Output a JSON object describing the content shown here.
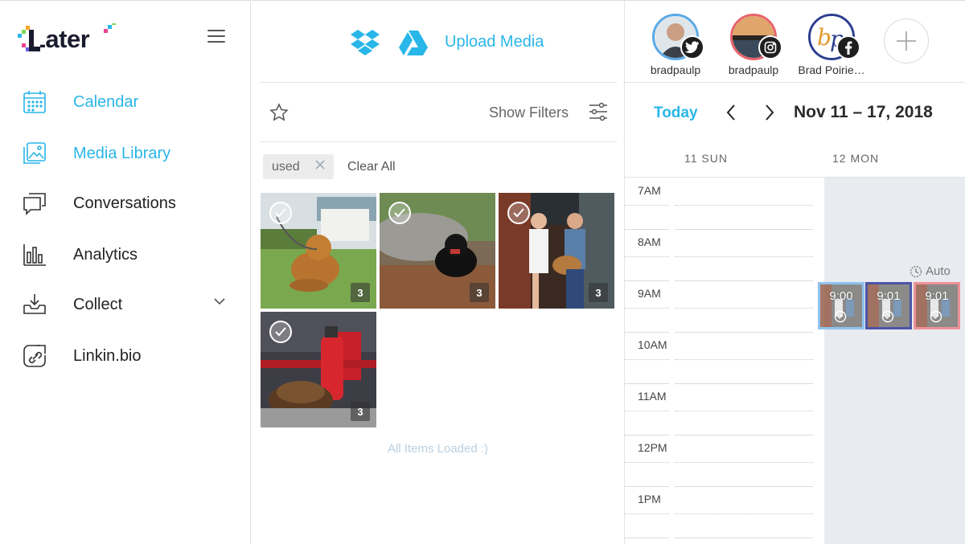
{
  "app": {
    "brand": "Later"
  },
  "sidebar": {
    "items": [
      {
        "label": "Calendar",
        "icon": "calendar-icon",
        "active": true
      },
      {
        "label": "Media Library",
        "icon": "image-icon",
        "active": true
      },
      {
        "label": "Conversations",
        "icon": "chat-icon",
        "active": false
      },
      {
        "label": "Analytics",
        "icon": "bar-chart-icon",
        "active": false
      },
      {
        "label": "Collect",
        "icon": "download-tray-icon",
        "active": false
      },
      {
        "label": "Linkin.bio",
        "icon": "link-icon",
        "active": false
      }
    ]
  },
  "media": {
    "upload_label": "Upload Media",
    "show_filters": "Show Filters",
    "active_tag": "used",
    "clear_all": "Clear All",
    "items": [
      {
        "subject": "dog on grass",
        "count": "3"
      },
      {
        "subject": "black dog on mulch",
        "count": "3"
      },
      {
        "subject": "street musicians",
        "count": "3"
      },
      {
        "subject": "firefighter with extinguisher",
        "count": "3"
      }
    ],
    "loaded_message": "All Items Loaded :)"
  },
  "calendar": {
    "profiles": [
      {
        "name": "bradpaulp",
        "network": "twitter",
        "ring_color": "#5aa9e6"
      },
      {
        "name": "bradpaulp",
        "network": "instagram",
        "ring_color": "#e8636c"
      },
      {
        "name": "Brad Poirie…",
        "network": "facebook",
        "ring_color": "#2c3e8f"
      }
    ],
    "today_label": "Today",
    "date_range": "Nov 11 – 17, 2018",
    "days": [
      "11 SUN",
      "12 MON"
    ],
    "hours": [
      "7AM",
      "8AM",
      "9AM",
      "10AM",
      "11AM",
      "12PM",
      "1PM"
    ],
    "auto_label": "Auto",
    "events": [
      {
        "time": "9:00",
        "color": "#8fc3ee"
      },
      {
        "time": "9:01",
        "color": "#4a55a8"
      },
      {
        "time": "9:01",
        "color": "#ee9196"
      }
    ]
  },
  "colors": {
    "accent": "#29b6e8"
  }
}
